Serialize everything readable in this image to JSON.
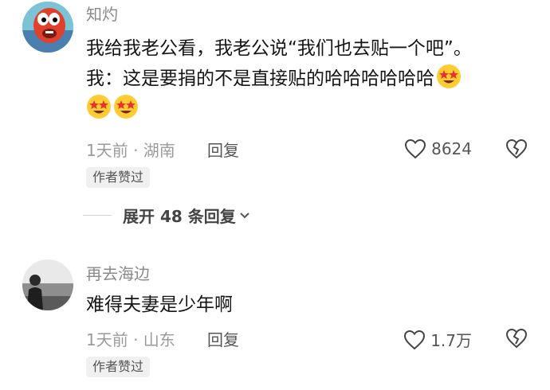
{
  "comments": [
    {
      "username": "知灼",
      "body_lines": [
        "我给我老公看，我老公说“我们也去贴一个吧”。",
        "我：这是要捐的不是直接贴的哈哈哈哈哈哈"
      ],
      "emoji": "star-struck-emoji",
      "time_location": "1天前 · 湖南",
      "reply_label": "回复",
      "like_count": "8624",
      "badge": "作者赞过",
      "expand_label": "展开 48 条回复"
    },
    {
      "username": "再去海边",
      "body_lines": [
        "难得夫妻是少年啊"
      ],
      "time_location": "1天前 · 山东",
      "reply_label": "回复",
      "like_count": "1.7万",
      "badge": "作者赞过"
    }
  ],
  "colors": {
    "username": "#8a8a8a",
    "meta": "#9a9a9a",
    "text": "#151515",
    "badge_bg": "#f0f0f0"
  }
}
